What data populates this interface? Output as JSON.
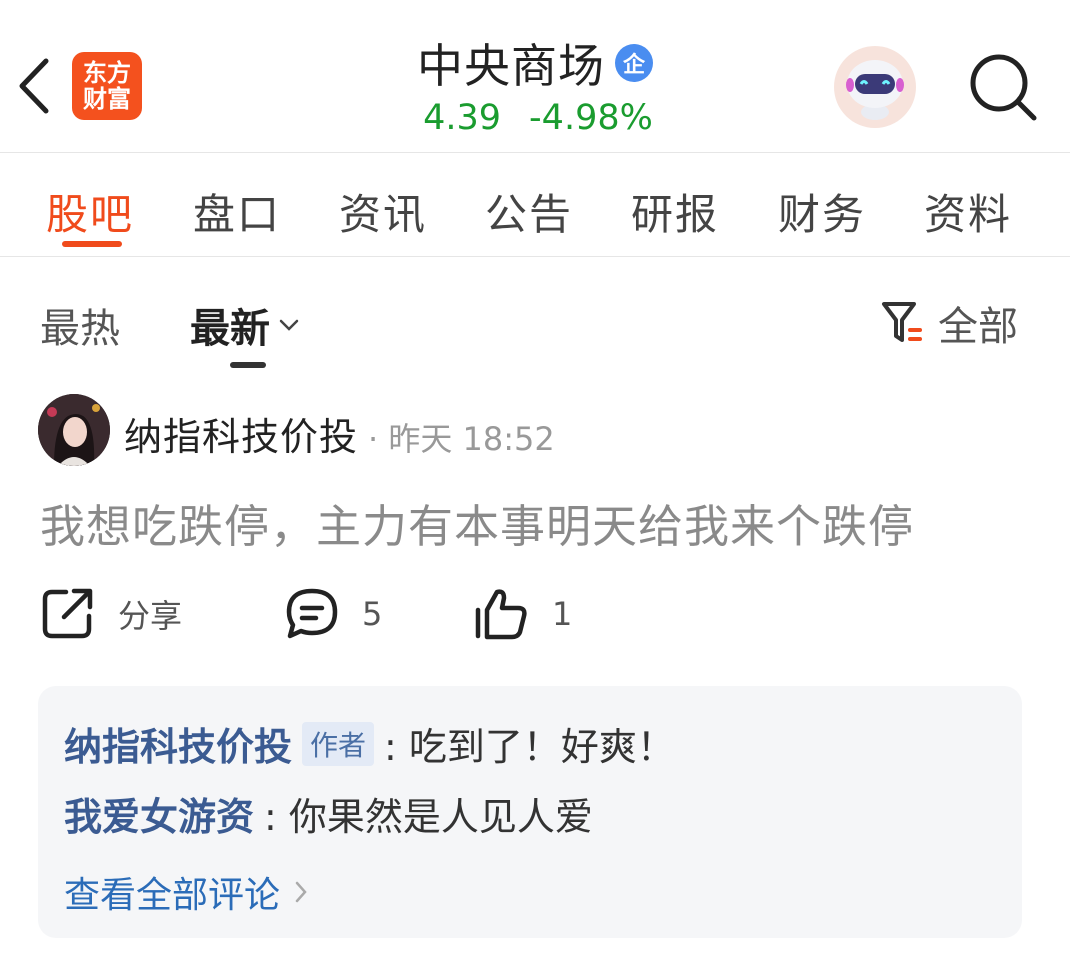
{
  "header": {
    "logo_line1": "东方",
    "logo_line2": "财富",
    "stock_name": "中央商场",
    "stock_badge": "企",
    "price": "4.39",
    "change": "-4.98%",
    "price_color": "#1a9c2f"
  },
  "tabs": [
    {
      "label": "股吧",
      "active": true
    },
    {
      "label": "盘口"
    },
    {
      "label": "资讯"
    },
    {
      "label": "公告"
    },
    {
      "label": "研报"
    },
    {
      "label": "财务"
    },
    {
      "label": "资料"
    }
  ],
  "sort": {
    "hot": "最热",
    "new": "最新",
    "filter": "全部"
  },
  "post": {
    "author": "纳指科技价投",
    "time": "· 昨天 18:52",
    "body": "我想吃跌停，主力有本事明天给我来个跌停",
    "share_label": "分享",
    "comment_count": "5",
    "like_count": "1"
  },
  "comments": {
    "items": [
      {
        "user": "纳指科技价投",
        "tag": "作者",
        "text": ": 吃到了！好爽！"
      },
      {
        "user": "我爱女游资",
        "text": ": 你果然是人见人爱"
      }
    ],
    "view_all": "查看全部评论"
  },
  "colors": {
    "accent": "#f04b1c",
    "link": "#2b6cb8"
  }
}
